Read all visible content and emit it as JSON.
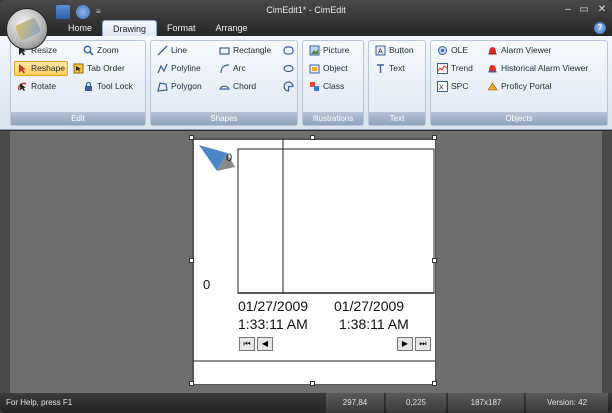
{
  "window": {
    "title": "CimEdit1* - CimEdit",
    "controls": [
      "–",
      "▭",
      "✕"
    ]
  },
  "qat": {
    "more": "≡"
  },
  "tabs": [
    "Home",
    "Drawing",
    "Format",
    "Arrange"
  ],
  "active_tab": "Drawing",
  "ribbon": {
    "edit": {
      "label": "Edit",
      "items": [
        "Resize",
        "Zoom",
        "Reshape",
        "Tab Order",
        "Rotate",
        "Tool Lock"
      ]
    },
    "shapes": {
      "label": "Shapes",
      "items": [
        "Line",
        "Rectangle",
        "Polyline",
        "Arc",
        "Polygon",
        "Chord"
      ]
    },
    "illustrations": {
      "label": "Illustrations",
      "items": [
        "Picture",
        "Object",
        "Class"
      ]
    },
    "text": {
      "label": "Text",
      "items": [
        "Button",
        "Text"
      ]
    },
    "objects": {
      "label": "Objects",
      "items": [
        "OLE",
        "Alarm Viewer",
        "Trend",
        "Historical Alarm Viewer",
        "SPC",
        "Proficy Portal"
      ]
    }
  },
  "trend": {
    "y_top_label": "0",
    "y_bottom_label": "0",
    "x_labels": [
      {
        "date": "01/27/2009",
        "time": "1:33:11 AM"
      },
      {
        "date": "01/27/2009",
        "time": "1:38:11 AM"
      }
    ],
    "nav_buttons": [
      "⏮",
      "◀",
      "▶",
      "⏭"
    ]
  },
  "status": {
    "help": "For Help, press F1",
    "cursor": "297,84",
    "position": "0,225",
    "size": "187x187",
    "version": "Version: 42"
  },
  "colors": {
    "ribbon_bg": "#dfe7f1",
    "selected": "#ffcf5a",
    "workspace": "#6e6e6e"
  }
}
